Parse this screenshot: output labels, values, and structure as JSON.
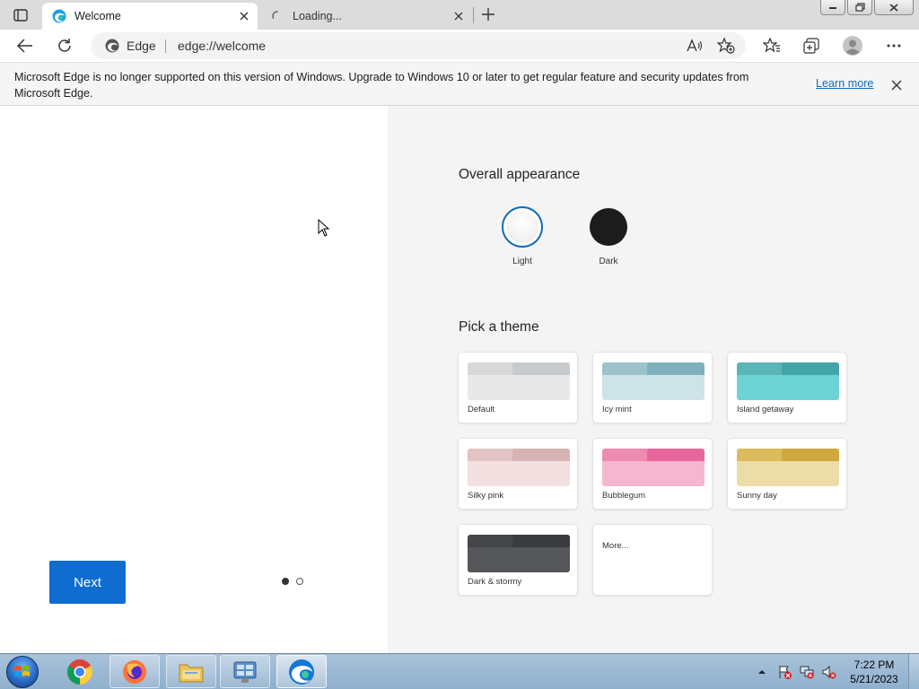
{
  "tabs": [
    {
      "title": "Welcome",
      "favicon": "edge-icon",
      "active": true
    },
    {
      "title": "Loading...",
      "favicon": "loading-spinner-icon",
      "active": false
    }
  ],
  "toolbar": {
    "site_label": "Edge",
    "url": "edge://welcome"
  },
  "infobar": {
    "message": "Microsoft Edge is no longer supported on this version of Windows. Upgrade to Windows 10 or later to get regular feature and security updates from Microsoft Edge.",
    "link": "Learn more"
  },
  "welcome": {
    "next_label": "Next",
    "pager": {
      "current": 1,
      "total": 2
    }
  },
  "appearance": {
    "title": "Overall appearance",
    "options": [
      {
        "label": "Light",
        "selected": true
      },
      {
        "label": "Dark",
        "selected": false
      }
    ]
  },
  "themes": {
    "title": "Pick a theme",
    "items": [
      {
        "name": "Default",
        "tab": "#c8cbce",
        "back": "#d7d8da",
        "front": "#e8e8e8"
      },
      {
        "name": "Icy mint",
        "tab": "#7fb1bd",
        "back": "#9cc3cc",
        "front": "#cde3e7"
      },
      {
        "name": "Island getaway",
        "tab": "#43a5a7",
        "back": "#5ab5b6",
        "front": "#6dd2d4"
      },
      {
        "name": "Silky pink",
        "tab": "#d8b3b3",
        "back": "#e3c3c3",
        "front": "#f2e0e0"
      },
      {
        "name": "Bubblegum",
        "tab": "#e8669b",
        "back": "#ef8ab1",
        "front": "#f5b7cf"
      },
      {
        "name": "Sunny day",
        "tab": "#cfa93d",
        "back": "#dcbb5a",
        "front": "#ecdca8"
      },
      {
        "name": "Dark & stormy",
        "tab": "#3a3b3e",
        "back": "#45464a",
        "front": "#55565a"
      }
    ],
    "more_label": "More..."
  },
  "taskbar": {
    "apps": [
      "chrome-icon",
      "firefox-icon",
      "file-explorer-icon",
      "control-panel-icon",
      "edge-icon"
    ],
    "time": "7:22 PM",
    "date": "5/21/2023"
  },
  "colors": {
    "accent": "#0f6cd0",
    "link": "#0f6cbd"
  }
}
